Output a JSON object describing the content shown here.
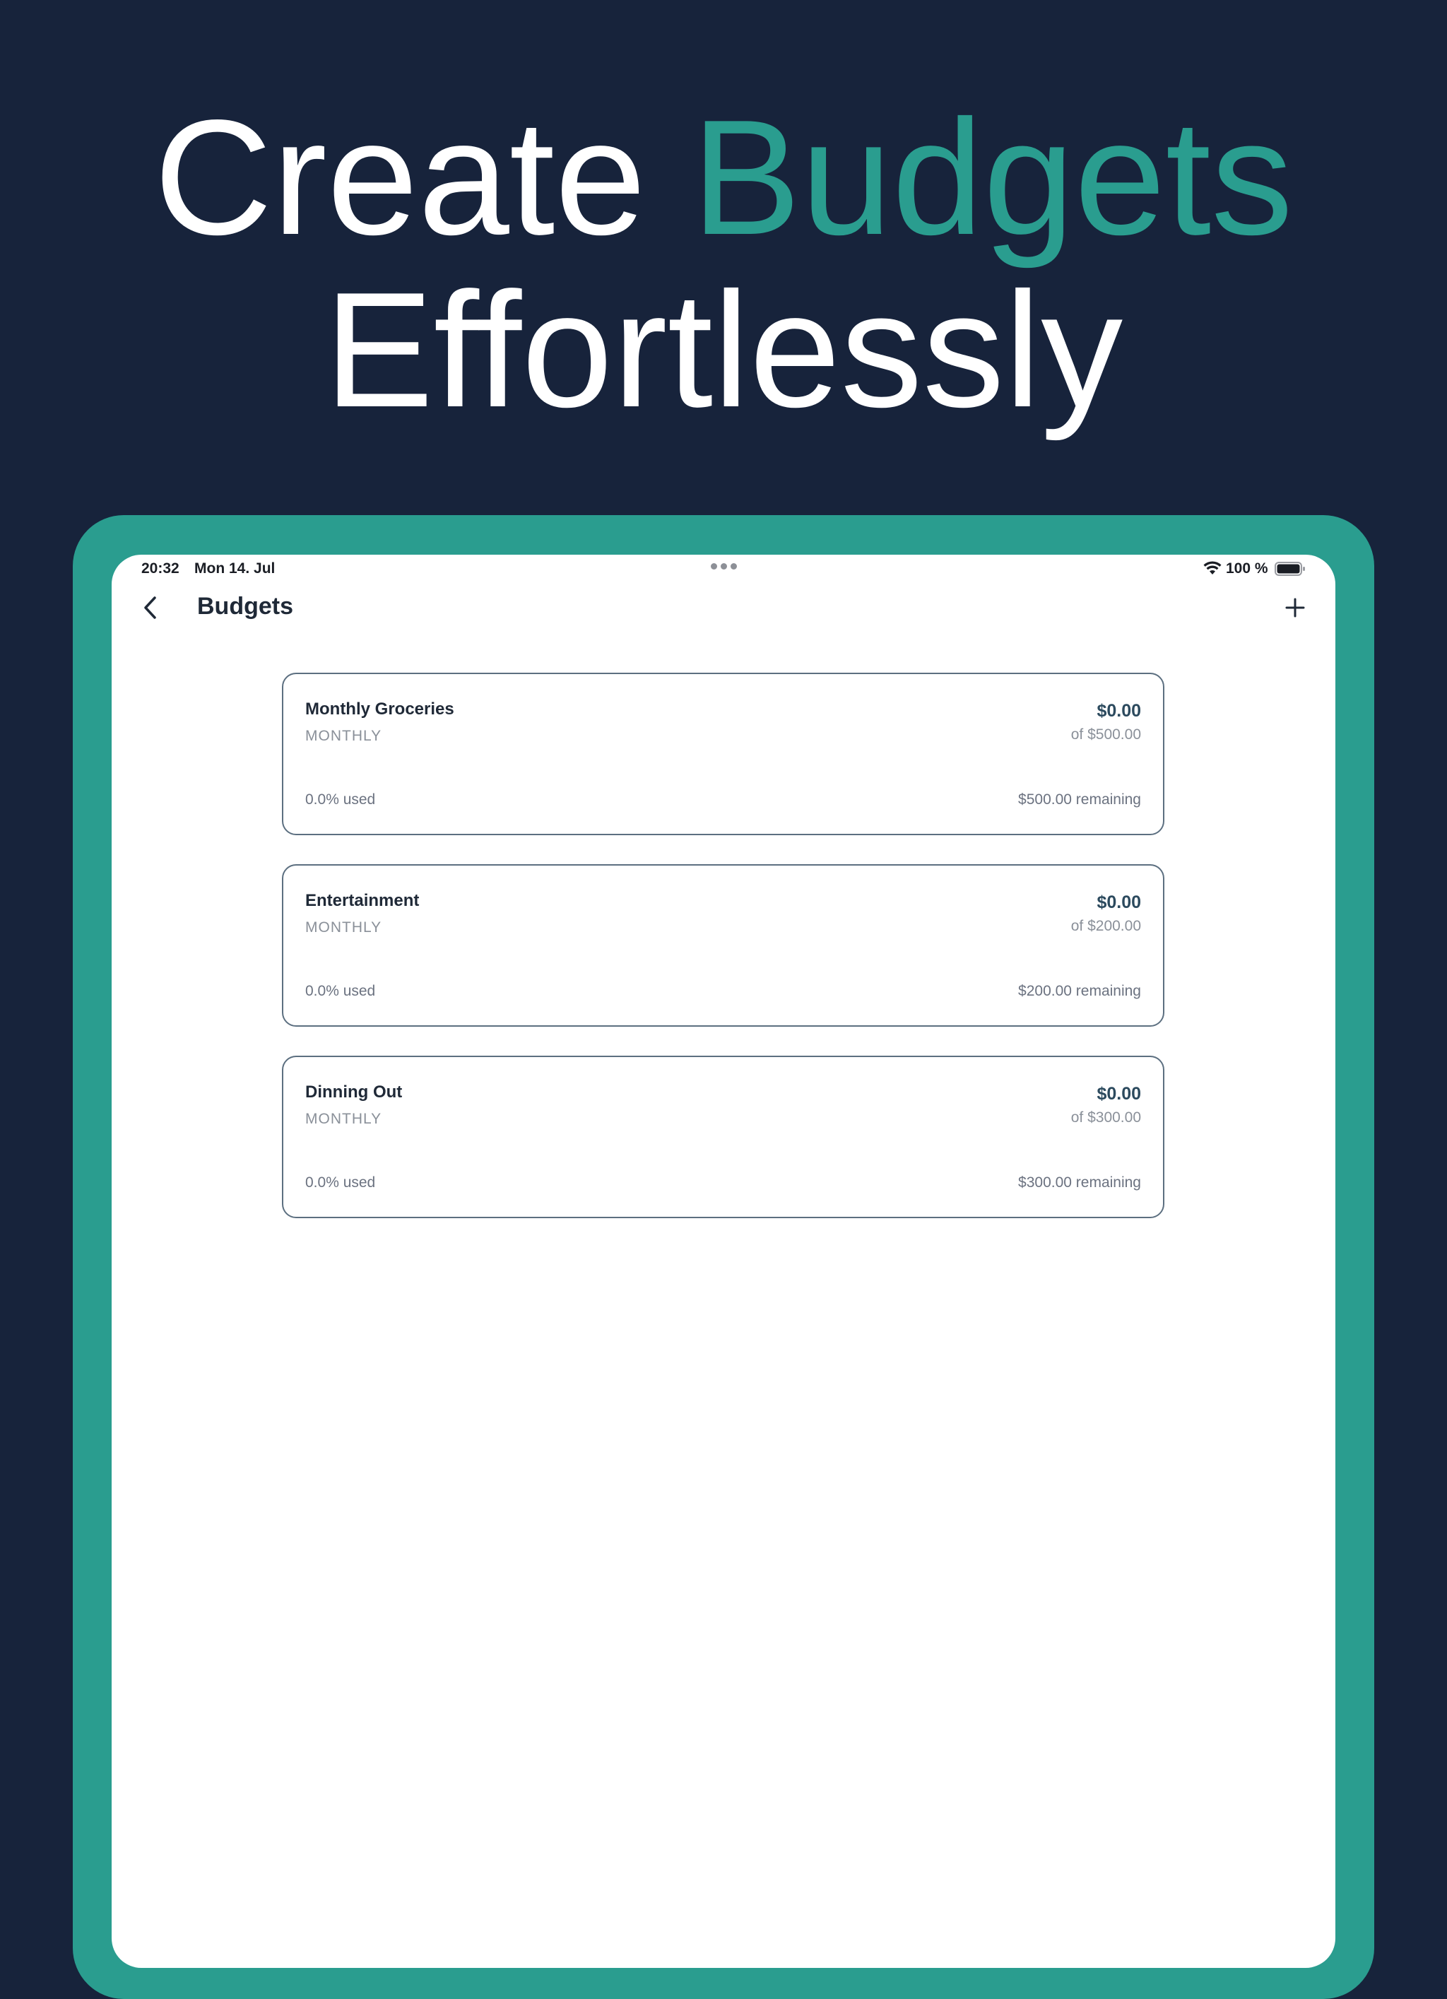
{
  "headline": {
    "line1_part1": "Create ",
    "line1_part2": "Budgets",
    "line2": "Effortlessly"
  },
  "colors": {
    "background": "#17233b",
    "accent": "#2a9d8f",
    "card_border": "#5c6f80",
    "amount_text": "#2c4a5e"
  },
  "status_bar": {
    "time": "20:32",
    "date": "Mon 14. Jul",
    "battery": "100 %"
  },
  "nav": {
    "title": "Budgets",
    "back_icon": "chevron-left-icon",
    "add_icon": "plus-icon"
  },
  "budgets": [
    {
      "name": "Monthly Groceries",
      "period": "MONTHLY",
      "spent": "$0.00",
      "limit": "of $500.00",
      "used": "0.0% used",
      "remaining": "$500.00 remaining"
    },
    {
      "name": "Entertainment",
      "period": "MONTHLY",
      "spent": "$0.00",
      "limit": "of $200.00",
      "used": "0.0% used",
      "remaining": "$200.00 remaining"
    },
    {
      "name": "Dinning Out",
      "period": "MONTHLY",
      "spent": "$0.00",
      "limit": "of $300.00",
      "used": "0.0% used",
      "remaining": "$300.00 remaining"
    }
  ]
}
